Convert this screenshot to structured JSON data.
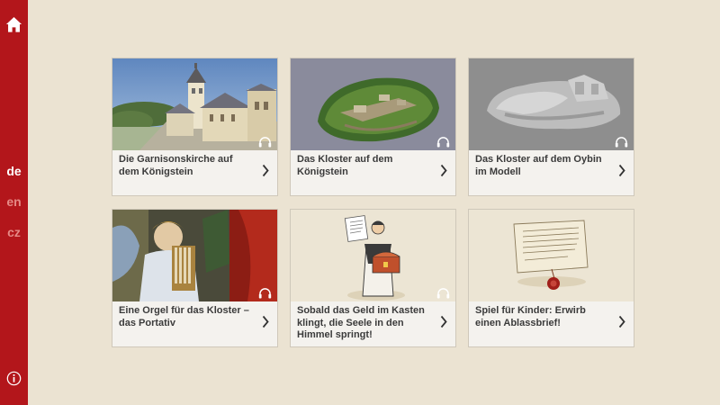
{
  "sidebar": {
    "home_icon": "home-icon",
    "languages": [
      {
        "code": "de",
        "active": true
      },
      {
        "code": "en",
        "active": false
      },
      {
        "code": "cz",
        "active": false
      }
    ],
    "info_icon": "info-icon",
    "colors": {
      "background": "#b3161b",
      "active": "#ffffff",
      "inactive": "#e58a86"
    }
  },
  "cards": [
    {
      "title": "Die Garnisonskirche auf dem Königstein",
      "image": "church-photo",
      "audio": true
    },
    {
      "title": "Das Kloster auf dem Königstein",
      "image": "fortress-3d-model",
      "audio": true
    },
    {
      "title": "Das Kloster auf dem Oybin im Modell",
      "image": "oybin-grey-model",
      "audio": true
    },
    {
      "title": "Eine Orgel für das Kloster – das Portativ",
      "image": "angel-organ-painting",
      "audio": true
    },
    {
      "title": "Sobald das Geld im Kasten klingt, die Seele in den Himmel springt!",
      "image": "monk-money-box-illustration",
      "audio": true
    },
    {
      "title": "Spiel für Kinder: Erwirb einen Ablassbrief!",
      "image": "indulgence-letter-illustration",
      "audio": false
    }
  ],
  "colors": {
    "page_background": "#ebe3d2",
    "card_background": "#f4f2ee",
    "title_text": "#3b3b3b"
  }
}
